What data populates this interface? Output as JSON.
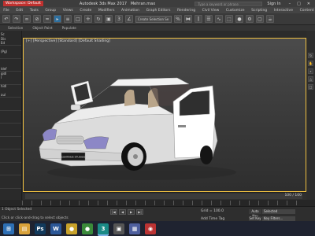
{
  "window": {
    "workspace_badge": "Workspace: Default",
    "title": "Autodesk 3ds Max 2017",
    "file": "Mehran.max",
    "search_placeholder": "Type a keyword or phrase",
    "sign_in": "Sign In"
  },
  "menu": [
    "File",
    "Edit",
    "Tools",
    "Group",
    "Views",
    "Create",
    "Modifiers",
    "Animation",
    "Graph Editors",
    "Rendering",
    "Civil View",
    "Customize",
    "Scripting",
    "Interactive",
    "Content",
    "Help"
  ],
  "toolbar": {
    "create_selection_set": "Create Selection Se",
    "icons": [
      "undo-icon",
      "redo-icon",
      "link-icon",
      "unlink-icon",
      "bind-icon",
      "select-icon",
      "select-name-icon",
      "region-icon",
      "move-icon",
      "rotate-icon",
      "scale-icon",
      "snap-icon",
      "angle-snap-icon",
      "percent-snap-icon",
      "mirror-icon",
      "align-icon",
      "layers-icon",
      "curve-icon",
      "schematic-icon",
      "material-icon",
      "render-setup-icon",
      "render-frame-icon",
      "render-icon"
    ]
  },
  "explorer_tabs": [
    "Selection",
    "Object Paint",
    "Populate"
  ],
  "left_panel": {
    "rows": [
      "Sc",
      "Dis",
      "Ed",
      "",
      "(Pg)",
      "",
      "",
      "",
      "ldef",
      "gidl",
      "l",
      "",
      "hidl",
      "",
      "aul",
      "",
      "",
      "",
      "",
      "",
      "",
      "",
      "",
      "",
      "",
      "",
      "",
      "",
      "",
      "",
      "",
      "",
      "",
      "",
      "",
      "",
      "",
      ""
    ]
  },
  "viewport": {
    "label": "[+] [Perspective] [Standard] [Default Shading]",
    "plate_text": "CONTINUS STUDIOS"
  },
  "right_panel_icons": [
    "orbit-icon",
    "pan-icon",
    "zoom-icon",
    "fov-icon",
    "maximize-icon"
  ],
  "timeline": {
    "frame": "100 / 100"
  },
  "status": {
    "selection": "1 Object Selected",
    "hint": "Click or click-and-drag to select objects",
    "grid": "Grid = 100.0",
    "add_time_tag": "Add Time Tag",
    "auto_key": "Auto Key",
    "selected": "Selected",
    "set_key": "Set Key",
    "key_filters": "Key Filters..."
  },
  "taskbar": [
    {
      "name": "windows-start-icon",
      "glyph": "⊞",
      "color": "#2d6fb5"
    },
    {
      "name": "explorer-icon",
      "glyph": "▤",
      "color": "#d9a23a"
    },
    {
      "name": "photoshop-icon",
      "glyph": "Ps",
      "color": "#123a5c"
    },
    {
      "name": "word-icon",
      "glyph": "W",
      "color": "#2b5797"
    },
    {
      "name": "chrome-icon",
      "glyph": "●",
      "color": "#c8a22b"
    },
    {
      "name": "camtasia-icon",
      "glyph": "●",
      "color": "#3a8a3a"
    },
    {
      "name": "3dsmax-icon",
      "glyph": "3",
      "color": "#1a8a86"
    },
    {
      "name": "media-icon",
      "glyph": "▣",
      "color": "#555555"
    },
    {
      "name": "paint-icon",
      "glyph": "▦",
      "color": "#4e5f9e"
    },
    {
      "name": "screen-recorder-icon",
      "glyph": "◉",
      "color": "#b33"
    }
  ]
}
